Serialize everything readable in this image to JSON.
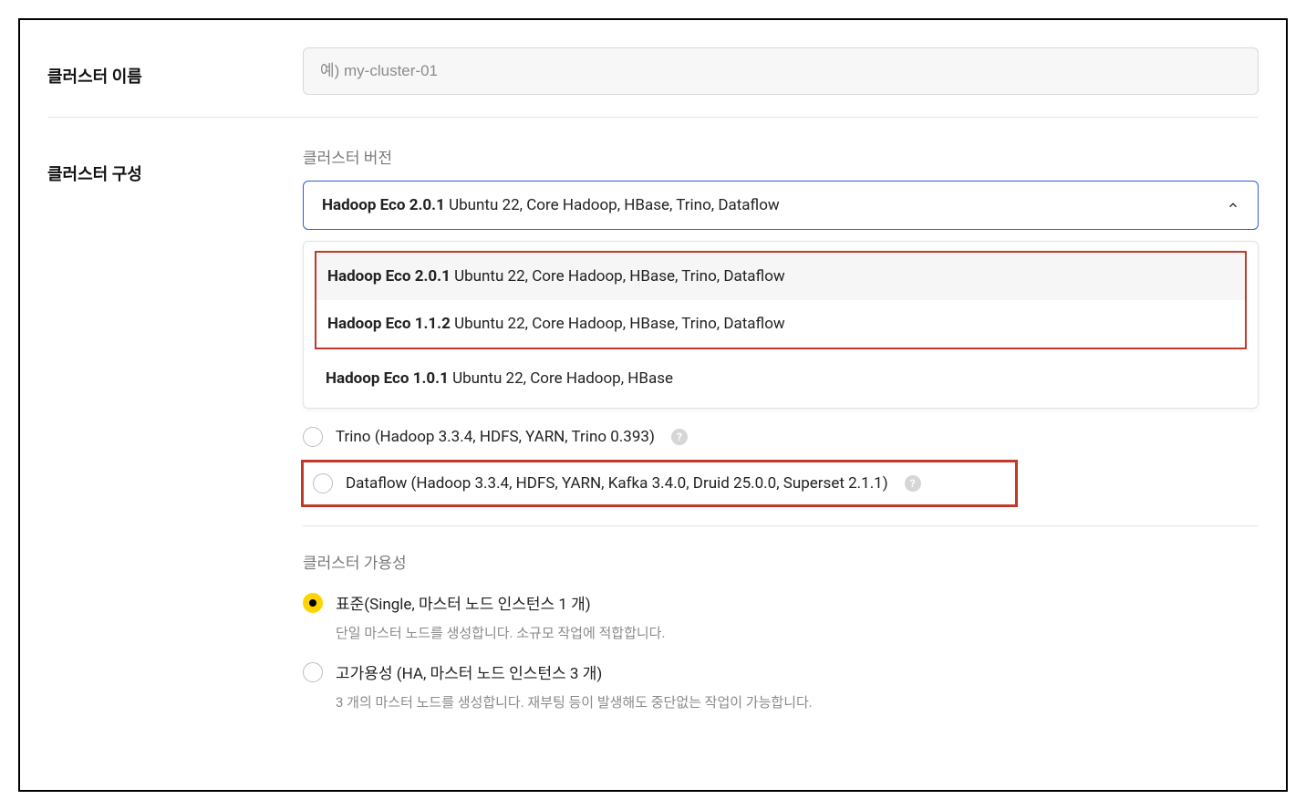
{
  "clusterName": {
    "label": "클러스터 이름",
    "placeholder": "예) my-cluster-01"
  },
  "clusterConfig": {
    "label": "클러스터 구성",
    "versionSection": {
      "subLabel": "클러스터 버전",
      "selected": {
        "bold": "Hadoop Eco 2.0.1",
        "rest": " Ubuntu 22, Core Hadoop, HBase, Trino, Dataflow"
      },
      "options": [
        {
          "bold": "Hadoop Eco 2.0.1",
          "rest": " Ubuntu 22, Core Hadoop, HBase, Trino, Dataflow"
        },
        {
          "bold": "Hadoop Eco 1.1.2",
          "rest": " Ubuntu 22, Core Hadoop, HBase, Trino, Dataflow"
        },
        {
          "bold": "Hadoop Eco 1.0.1",
          "rest": " Ubuntu 22, Core Hadoop, HBase"
        }
      ]
    },
    "typeOptions": {
      "trino": "Trino (Hadoop 3.3.4, HDFS, YARN, Trino 0.393)",
      "dataflow": "Dataflow (Hadoop 3.3.4, HDFS, YARN, Kafka 3.4.0, Druid 25.0.0, Superset 2.1.1)"
    },
    "availability": {
      "subLabel": "클러스터 가용성",
      "standard": {
        "label": "표준(Single, 마스터 노드 인스턴스 1 개)",
        "desc": "단일 마스터 노드를 생성합니다. 소규모 작업에 적합합니다."
      },
      "ha": {
        "label": "고가용성 (HA, 마스터 노드 인스턴스 3 개)",
        "desc": "3 개의 마스터 노드를 생성합니다. 재부팅 등이 발생해도 중단없는 작업이 가능합니다."
      }
    }
  },
  "icons": {
    "help": "?"
  }
}
